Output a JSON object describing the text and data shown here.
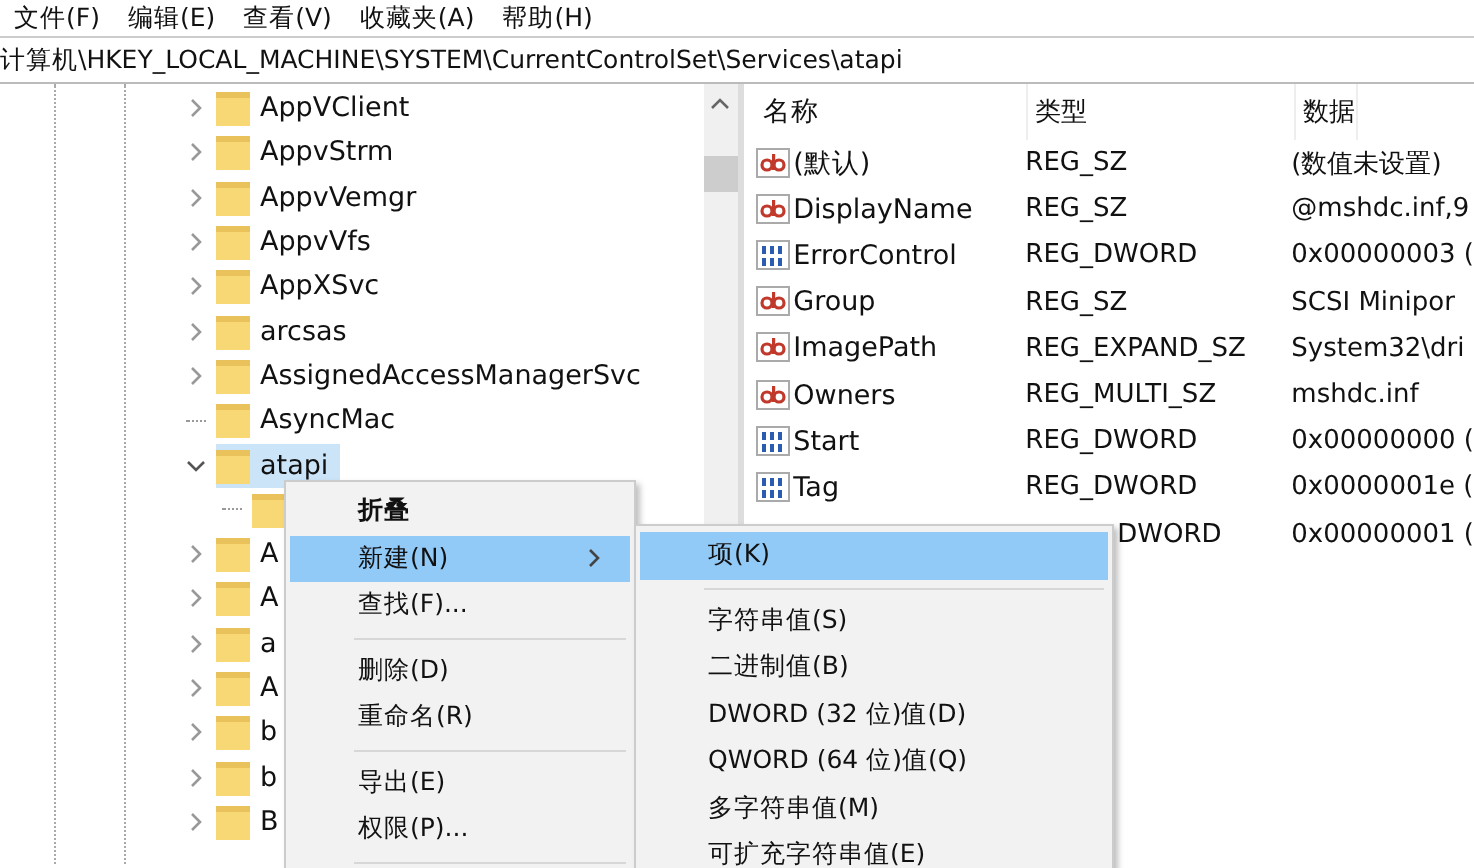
{
  "menu_bar": [
    "文件(F)",
    "编辑(E)",
    "查看(V)",
    "收藏夹(A)",
    "帮助(H)"
  ],
  "address": "计算机\\HKEY_LOCAL_MACHINE\\SYSTEM\\CurrentControlSet\\Services\\atapi",
  "tree": {
    "items": [
      {
        "label": "AppVClient",
        "expanded": false,
        "selected": false
      },
      {
        "label": "AppvStrm",
        "expanded": false,
        "selected": false
      },
      {
        "label": "AppvVemgr",
        "expanded": false,
        "selected": false
      },
      {
        "label": "AppvVfs",
        "expanded": false,
        "selected": false
      },
      {
        "label": "AppXSvc",
        "expanded": false,
        "selected": false
      },
      {
        "label": "arcsas",
        "expanded": false,
        "selected": false
      },
      {
        "label": "AssignedAccessManagerSvc",
        "expanded": false,
        "selected": false
      },
      {
        "label": "AsyncMac",
        "kind": "leaf",
        "selected": false
      },
      {
        "label": "atapi",
        "expanded": true,
        "selected": true,
        "children": [
          {
            "selected": false
          }
        ]
      },
      {
        "label": "A",
        "expanded": false,
        "selected": false
      },
      {
        "label": "A",
        "expanded": false,
        "selected": false
      },
      {
        "label": "a",
        "expanded": false,
        "selected": false
      },
      {
        "label": "A",
        "expanded": false,
        "selected": false
      },
      {
        "label": "b",
        "expanded": false,
        "selected": false
      },
      {
        "label": "b",
        "expanded": false,
        "selected": false
      },
      {
        "label": "B",
        "expanded": false,
        "selected": false
      }
    ]
  },
  "values": {
    "columns": [
      "名称",
      "类型",
      "数据"
    ],
    "rows": [
      {
        "kind": "string",
        "name": "(默认)",
        "type": "REG_SZ",
        "data": "(数值未设置)"
      },
      {
        "kind": "string",
        "name": "DisplayName",
        "type": "REG_SZ",
        "data": "@mshdc.inf,9"
      },
      {
        "kind": "binary",
        "name": "ErrorControl",
        "type": "REG_DWORD",
        "data": "0x00000003 ("
      },
      {
        "kind": "string",
        "name": "Group",
        "type": "REG_SZ",
        "data": "SCSI Minipor"
      },
      {
        "kind": "string",
        "name": "ImagePath",
        "type": "REG_EXPAND_SZ",
        "data": "System32\\dri"
      },
      {
        "kind": "string",
        "name": "Owners",
        "type": "REG_MULTI_SZ",
        "data": "mshdc.inf"
      },
      {
        "kind": "binary",
        "name": "Start",
        "type": "REG_DWORD",
        "data": "0x00000000 ("
      },
      {
        "kind": "binary",
        "name": "Tag",
        "type": "REG_DWORD",
        "data": "0x0000001e ("
      },
      {
        "kind": "hidden",
        "type": "DWORD",
        "data": "0x00000001 ("
      }
    ]
  },
  "context_menu": [
    {
      "kind": "item",
      "label": "折叠",
      "bold": true,
      "selected": false
    },
    {
      "kind": "submenu",
      "label": "新建(N)",
      "bold": false,
      "selected": true
    },
    {
      "kind": "item",
      "label": "查找(F)...",
      "bold": false,
      "selected": false
    },
    {
      "kind": "separator"
    },
    {
      "kind": "item",
      "label": "删除(D)",
      "bold": false,
      "selected": false
    },
    {
      "kind": "item",
      "label": "重命名(R)",
      "bold": false,
      "selected": false
    },
    {
      "kind": "separator"
    },
    {
      "kind": "item",
      "label": "导出(E)",
      "bold": false,
      "selected": false
    },
    {
      "kind": "item",
      "label": "权限(P)...",
      "bold": false,
      "selected": false
    },
    {
      "kind": "separator"
    }
  ],
  "submenu": [
    {
      "kind": "item",
      "label": "项(K)",
      "selected": true
    },
    {
      "kind": "separator"
    },
    {
      "kind": "item",
      "label": "字符串值(S)",
      "selected": false
    },
    {
      "kind": "item",
      "label": "二进制值(B)",
      "selected": false
    },
    {
      "kind": "item",
      "label": "DWORD (32 位)值(D)",
      "selected": false
    },
    {
      "kind": "item",
      "label": "QWORD (64 位)值(Q)",
      "selected": false
    },
    {
      "kind": "item",
      "label": "多字符串值(M)",
      "selected": false
    },
    {
      "kind": "item",
      "label": "可扩充字符串值(E)",
      "selected": false
    }
  ]
}
